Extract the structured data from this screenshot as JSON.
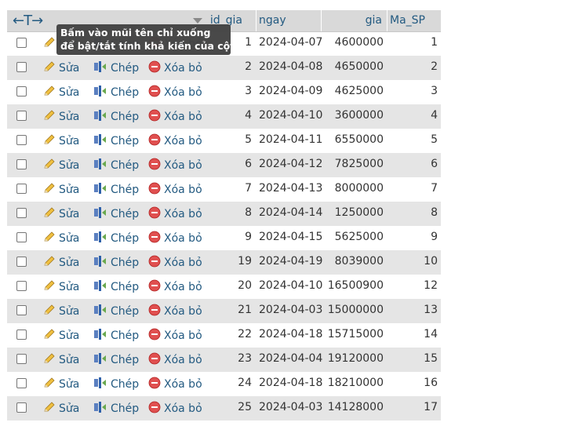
{
  "header": {
    "columns": {
      "id": "id_gia",
      "ngay": "ngay",
      "gia": "gia",
      "ma": "Ma_SP"
    }
  },
  "tooltip": {
    "line1": "Bấm vào mũi tên chỉ xuống",
    "line2": "để bật/tắt tính khả kiến của cột."
  },
  "actions": {
    "edit": "Sửa",
    "copy": "Chép",
    "delete": "Xóa bỏ"
  },
  "rows": [
    {
      "id": "1",
      "ngay": "2024-04-07",
      "gia": "4600000",
      "ma": "1"
    },
    {
      "id": "2",
      "ngay": "2024-04-08",
      "gia": "4650000",
      "ma": "2"
    },
    {
      "id": "3",
      "ngay": "2024-04-09",
      "gia": "4625000",
      "ma": "3"
    },
    {
      "id": "4",
      "ngay": "2024-04-10",
      "gia": "3600000",
      "ma": "4"
    },
    {
      "id": "5",
      "ngay": "2024-04-11",
      "gia": "6550000",
      "ma": "5"
    },
    {
      "id": "6",
      "ngay": "2024-04-12",
      "gia": "7825000",
      "ma": "6"
    },
    {
      "id": "7",
      "ngay": "2024-04-13",
      "gia": "8000000",
      "ma": "7"
    },
    {
      "id": "8",
      "ngay": "2024-04-14",
      "gia": "1250000",
      "ma": "8"
    },
    {
      "id": "9",
      "ngay": "2024-04-15",
      "gia": "5625000",
      "ma": "9"
    },
    {
      "id": "19",
      "ngay": "2024-04-19",
      "gia": "8039000",
      "ma": "10"
    },
    {
      "id": "20",
      "ngay": "2024-04-10",
      "gia": "16500900",
      "ma": "12"
    },
    {
      "id": "21",
      "ngay": "2024-04-03",
      "gia": "15000000",
      "ma": "13"
    },
    {
      "id": "22",
      "ngay": "2024-04-18",
      "gia": "15715000",
      "ma": "14"
    },
    {
      "id": "23",
      "ngay": "2024-04-04",
      "gia": "19120000",
      "ma": "15"
    },
    {
      "id": "24",
      "ngay": "2024-04-18",
      "gia": "18210000",
      "ma": "16"
    },
    {
      "id": "25",
      "ngay": "2024-04-03",
      "gia": "14128000",
      "ma": "17"
    }
  ]
}
